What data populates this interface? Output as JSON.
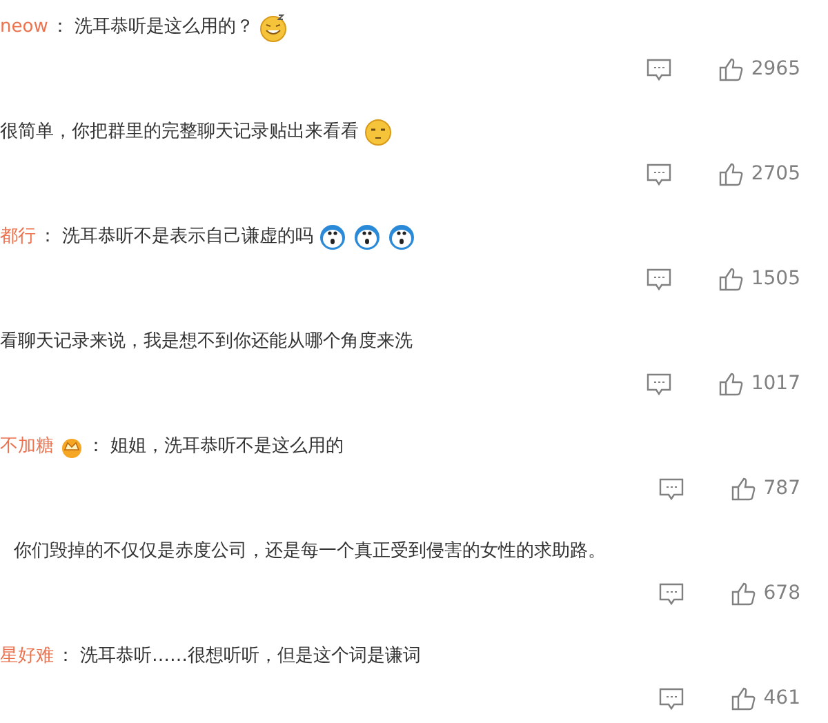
{
  "comments": [
    {
      "user": "neow",
      "separator": "：",
      "text": "洗耳恭听是这么用的？",
      "emojis": [
        {
          "kind": "grin"
        }
      ],
      "likes": "2965"
    },
    {
      "text": "很简单，你把群里的完整聊天记录贴出来看看",
      "emojis": [
        {
          "kind": "smirk"
        }
      ],
      "likes": "2705"
    },
    {
      "user": "都行",
      "separator": "：",
      "text": "洗耳恭听不是表示自己谦虚的吗",
      "emojis": [
        {
          "kind": "surprised"
        },
        {
          "kind": "surprised"
        },
        {
          "kind": "surprised"
        }
      ],
      "likes": "1505"
    },
    {
      "text": "看聊天记录来说，我是想不到你还能从哪个角度来洗",
      "likes": "1017"
    },
    {
      "user": "不加糖",
      "user_badge": {
        "kind": "crown"
      },
      "separator": "：",
      "text": "姐姐，洗耳恭听不是这么用的",
      "likes": "787"
    },
    {
      "text": "你们毁掉的不仅仅是赤度公司，还是每一个真正受到侵害的女性的求助路。",
      "indent": true,
      "likes": "678"
    },
    {
      "user": "星好难",
      "separator": "：",
      "text": "洗耳恭听……很想听听，但是这个词是谦词",
      "likes": "461"
    }
  ]
}
